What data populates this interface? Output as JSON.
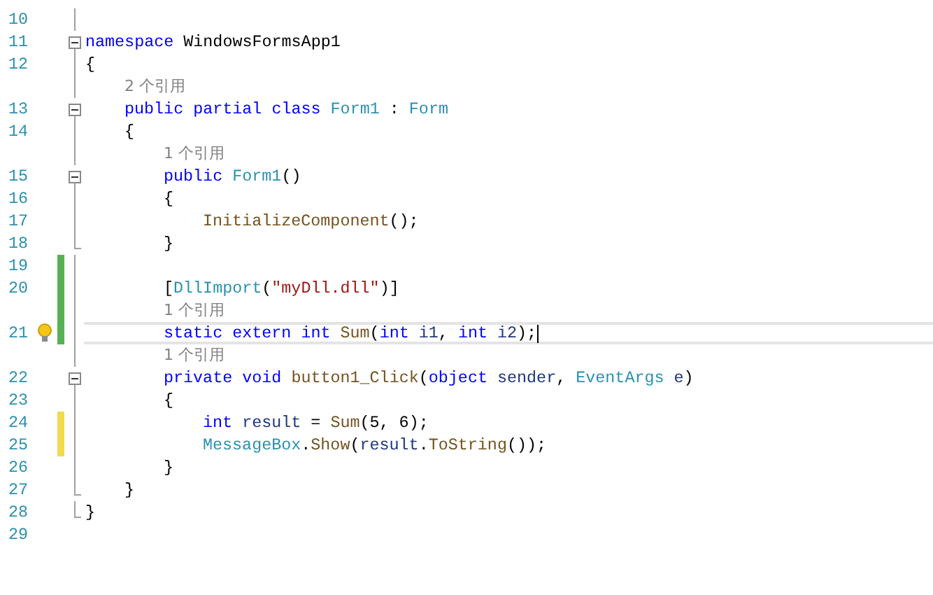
{
  "editor": {
    "rows": [
      {
        "kind": "code",
        "number": "10",
        "in_region": true
      },
      {
        "kind": "code",
        "number": "11",
        "collapsible": true,
        "expanded": true,
        "tokens": [
          {
            "kind": "keyword",
            "text": "namespace "
          },
          {
            "kind": "plain",
            "text": "WindowsFormsApp1"
          }
        ]
      },
      {
        "kind": "code",
        "number": "12",
        "in_region": true,
        "tokens": [
          {
            "kind": "plain",
            "text": "{"
          }
        ],
        "children": [
          {
            "kind": "codelens",
            "in_region": true,
            "text": "2 个引用"
          },
          {
            "kind": "code",
            "number": "13",
            "collapsible": true,
            "expanded": true,
            "tokens": [
              {
                "kind": "keyword",
                "text": "public partial class "
              },
              {
                "kind": "type",
                "text": "Form1"
              },
              {
                "kind": "plain",
                "text": " : "
              },
              {
                "kind": "type",
                "text": "Form"
              }
            ]
          },
          {
            "kind": "code",
            "number": "14",
            "in_region": true,
            "tokens": [
              {
                "kind": "plain",
                "text": "{"
              }
            ],
            "children": [
              {
                "kind": "codelens",
                "in_region": true,
                "text": "1 个引用"
              },
              {
                "kind": "code",
                "number": "15",
                "collapsible": true,
                "expanded": true,
                "tokens": [
                  {
                    "kind": "keyword",
                    "text": "public "
                  },
                  {
                    "kind": "type",
                    "text": "Form1"
                  },
                  {
                    "kind": "plain",
                    "text": "()"
                  }
                ]
              },
              {
                "kind": "code",
                "number": "16",
                "in_region": true,
                "tokens": [
                  {
                    "kind": "plain",
                    "text": "{"
                  }
                ],
                "children": [
                  {
                    "kind": "code",
                    "number": "17",
                    "in_region": true,
                    "tokens": [
                      {
                        "kind": "method",
                        "text": "InitializeComponent"
                      },
                      {
                        "kind": "plain",
                        "text": "();"
                      }
                    ]
                  }
                ]
              },
              {
                "kind": "code",
                "number": "18",
                "fold_end": true,
                "tokens": [
                  {
                    "kind": "plain",
                    "text": "}"
                  }
                ]
              },
              {
                "kind": "code",
                "number": "19",
                "in_region": true,
                "modified": true,
                "saved": true
              },
              {
                "kind": "code",
                "number": "20",
                "in_region": true,
                "modified": true,
                "saved": true,
                "tokens": [
                  {
                    "kind": "plain",
                    "text": "["
                  },
                  {
                    "kind": "type",
                    "text": "DllImport"
                  },
                  {
                    "kind": "plain",
                    "text": "("
                  },
                  {
                    "kind": "string",
                    "text": "\"myDll.dll\""
                  },
                  {
                    "kind": "plain",
                    "text": ")]"
                  }
                ]
              },
              {
                "kind": "codelens",
                "in_region": true,
                "modified": true,
                "saved": true,
                "text": "1 个引用"
              },
              {
                "kind": "code",
                "number": "21",
                "in_region": true,
                "modified": true,
                "saved": true,
                "current": true,
                "lightbulb": true,
                "caret": true,
                "tokens": [
                  {
                    "kind": "keyword",
                    "text": "static extern int "
                  },
                  {
                    "kind": "method",
                    "text": "Sum"
                  },
                  {
                    "kind": "plain",
                    "text": "("
                  },
                  {
                    "kind": "keyword",
                    "text": "int "
                  },
                  {
                    "kind": "variable",
                    "text": "i1"
                  },
                  {
                    "kind": "plain",
                    "text": ", "
                  },
                  {
                    "kind": "keyword",
                    "text": "int "
                  },
                  {
                    "kind": "variable",
                    "text": "i2"
                  },
                  {
                    "kind": "plain",
                    "text": ");"
                  }
                ]
              },
              {
                "kind": "codelens",
                "in_region": true,
                "text": "1 个引用"
              },
              {
                "kind": "code",
                "number": "22",
                "collapsible": true,
                "expanded": true,
                "tokens": [
                  {
                    "kind": "keyword",
                    "text": "private void "
                  },
                  {
                    "kind": "method",
                    "text": "button1_Click"
                  },
                  {
                    "kind": "plain",
                    "text": "("
                  },
                  {
                    "kind": "keyword",
                    "text": "object "
                  },
                  {
                    "kind": "variable",
                    "text": "sender"
                  },
                  {
                    "kind": "plain",
                    "text": ", "
                  },
                  {
                    "kind": "type",
                    "text": "EventArgs "
                  },
                  {
                    "kind": "variable",
                    "text": "e"
                  },
                  {
                    "kind": "plain",
                    "text": ")"
                  }
                ]
              },
              {
                "kind": "code",
                "number": "23",
                "in_region": true,
                "tokens": [
                  {
                    "kind": "plain",
                    "text": "{"
                  }
                ],
                "children": [
                  {
                    "kind": "code",
                    "number": "24",
                    "in_region": true,
                    "modified": true,
                    "saved": false,
                    "tokens": [
                      {
                        "kind": "keyword",
                        "text": "int "
                      },
                      {
                        "kind": "variable",
                        "text": "result"
                      },
                      {
                        "kind": "plain",
                        "text": " = "
                      },
                      {
                        "kind": "method",
                        "text": "Sum"
                      },
                      {
                        "kind": "plain",
                        "text": "(5, 6);"
                      }
                    ]
                  },
                  {
                    "kind": "code",
                    "number": "25",
                    "in_region": true,
                    "modified": true,
                    "saved": false,
                    "tokens": [
                      {
                        "kind": "type",
                        "text": "MessageBox"
                      },
                      {
                        "kind": "plain",
                        "text": "."
                      },
                      {
                        "kind": "method",
                        "text": "Show"
                      },
                      {
                        "kind": "plain",
                        "text": "("
                      },
                      {
                        "kind": "variable",
                        "text": "result"
                      },
                      {
                        "kind": "plain",
                        "text": "."
                      },
                      {
                        "kind": "method",
                        "text": "ToString"
                      },
                      {
                        "kind": "plain",
                        "text": "());"
                      }
                    ]
                  }
                ]
              },
              {
                "kind": "code",
                "number": "26",
                "in_region": true,
                "tokens": [
                  {
                    "kind": "plain",
                    "text": "}"
                  }
                ]
              }
            ]
          },
          {
            "kind": "code",
            "number": "27",
            "fold_end": true,
            "tokens": [
              {
                "kind": "plain",
                "text": "}"
              }
            ]
          }
        ]
      },
      {
        "kind": "code",
        "number": "28",
        "fold_end": true,
        "tokens": [
          {
            "kind": "plain",
            "text": "}"
          }
        ]
      },
      {
        "kind": "code",
        "number": "29"
      }
    ]
  }
}
